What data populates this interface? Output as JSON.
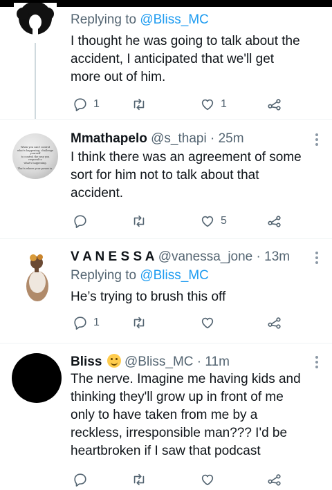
{
  "tweets": [
    {
      "reply_prefix": "Replying to ",
      "reply_handle": "@Bliss_MC",
      "text_lines": [
        "I thought he was going to talk about the",
        "accident, I anticipated that we'll get",
        "more out of him."
      ],
      "reply_count": "1",
      "like_count": "1"
    },
    {
      "name": "Mmathapelo",
      "handle_time": "@s_thapi · 25m",
      "avatar_quote": [
        "When you can't control",
        "what's happening, challenge yourself",
        "to control the way you respond to",
        "what's happening.",
        "That's where your power is."
      ],
      "text_lines": [
        "I think there was an agreement of some",
        "sort for him not to talk about that",
        "accident."
      ],
      "like_count": "5"
    },
    {
      "name": "V A N E S S A",
      "handle_time": "@vanessa_jone · 13m",
      "reply_prefix": "Replying to ",
      "reply_handle": "@Bliss_MC",
      "text_lines": [
        "He’s trying to brush this off"
      ],
      "reply_count": "1"
    },
    {
      "name": "Bliss",
      "handle_time": "@Bliss_MC · 11m",
      "emoji": "smiling-face-emoji",
      "text_lines": [
        "The nerve. Imagine me having kids and",
        "thinking they'll grow up in front of me",
        "only to have taken from me by a",
        "reckless, irresponsible man??? I'd be",
        "heartbroken if I saw that podcast"
      ]
    }
  ],
  "icons": {
    "reply": "reply-icon",
    "retweet": "retweet-icon",
    "like": "heart-icon",
    "share": "share-icon",
    "more": "more-icon"
  },
  "colors": {
    "accent": "#1d9bf0",
    "muted": "#536471",
    "text": "#0f1419",
    "divider": "#eff3f4"
  }
}
